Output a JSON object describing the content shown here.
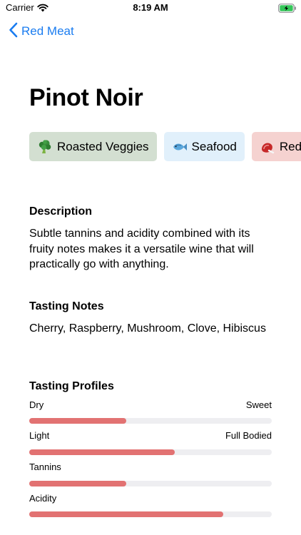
{
  "status": {
    "carrier": "Carrier",
    "time": "8:19 AM"
  },
  "nav": {
    "back_label": "Red Meat"
  },
  "wine": {
    "name": "Pinot Noir"
  },
  "pairings": [
    {
      "label": "Roasted Veggies",
      "icon": "broccoli-icon"
    },
    {
      "label": "Seafood",
      "icon": "fish-icon"
    },
    {
      "label": "Red",
      "icon": "meat-icon"
    }
  ],
  "description": {
    "heading": "Description",
    "text": "Subtle tannins and acidity combined with its fruity notes makes it a versatile wine that will practically go with anything."
  },
  "tasting_notes": {
    "heading": "Tasting Notes",
    "text": "Cherry, Raspberry, Mushroom, Clove, Hibiscus"
  },
  "tasting_profiles": {
    "heading": "Tasting Profiles",
    "items": [
      {
        "left_label": "Dry",
        "right_label": "Sweet",
        "level": 0.4
      },
      {
        "left_label": "Light",
        "right_label": "Full Bodied",
        "level": 0.6
      },
      {
        "left_label": "Tannins",
        "right_label": "",
        "level": 0.4
      },
      {
        "left_label": "Acidity",
        "right_label": "",
        "level": 0.8
      }
    ]
  },
  "colors": {
    "accent": "#1a7cf0",
    "bar_fill": "#e27272",
    "bar_track": "#eeeef1"
  }
}
